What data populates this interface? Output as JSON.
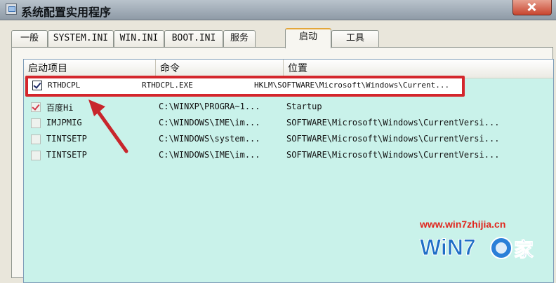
{
  "window": {
    "title": "系统配置实用程序"
  },
  "tabs": [
    {
      "label": "一般"
    },
    {
      "label": "SYSTEM.INI"
    },
    {
      "label": "WIN.INI"
    },
    {
      "label": "BOOT.INI"
    },
    {
      "label": "服务"
    },
    {
      "label": "启动"
    },
    {
      "label": "工具"
    }
  ],
  "active_tab": "启动",
  "list": {
    "columns": [
      "启动项目",
      "命令",
      "位置"
    ],
    "rows": [
      {
        "checked": true,
        "item": "RTHDCPL",
        "command": "RTHDCPL.EXE",
        "location": "HKLM\\SOFTWARE\\Microsoft\\Windows\\Current..."
      },
      {
        "checked": true,
        "item": "百度Hi",
        "command": "C:\\WINXP\\PROGRA~1...",
        "location": "Startup"
      },
      {
        "checked": false,
        "item": "IMJPMIG",
        "command": "C:\\WINDOWS\\IME\\im...",
        "location": "SOFTWARE\\Microsoft\\Windows\\CurrentVersi..."
      },
      {
        "checked": false,
        "item": "TINTSETP",
        "command": "C:\\WINDOWS\\system...",
        "location": "SOFTWARE\\Microsoft\\Windows\\CurrentVersi..."
      },
      {
        "checked": false,
        "item": "TINTSETP",
        "command": "C:\\WINDOWS\\IME\\im...",
        "location": "SOFTWARE\\Microsoft\\Windows\\CurrentVersi..."
      }
    ]
  },
  "watermark": {
    "url": "www.win7zhijia.cn",
    "logo_text": "WiN7.之家"
  },
  "colors": {
    "highlight_box": "#d4262c",
    "list_bg": "#c9f2ea",
    "active_tab_accent": "#e4a73a"
  }
}
